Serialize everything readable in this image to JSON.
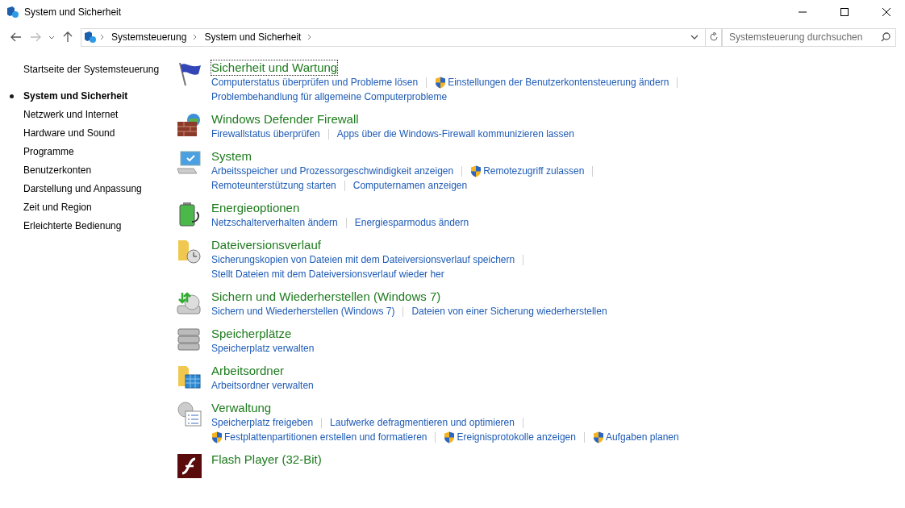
{
  "window": {
    "title": "System und Sicherheit"
  },
  "address_bar": {
    "crumbs": [
      "Systemsteuerung",
      "System und Sicherheit"
    ]
  },
  "search": {
    "placeholder": "Systemsteuerung durchsuchen"
  },
  "sidebar": {
    "items": [
      {
        "label": "Startseite der Systemsteuerung",
        "selected": false,
        "kind": "home"
      },
      {
        "label": "System und Sicherheit",
        "selected": true,
        "kind": "item"
      },
      {
        "label": "Netzwerk und Internet",
        "selected": false,
        "kind": "item"
      },
      {
        "label": "Hardware und Sound",
        "selected": false,
        "kind": "item"
      },
      {
        "label": "Programme",
        "selected": false,
        "kind": "item"
      },
      {
        "label": "Benutzerkonten",
        "selected": false,
        "kind": "item"
      },
      {
        "label": "Darstellung und Anpassung",
        "selected": false,
        "kind": "item"
      },
      {
        "label": "Zeit und Region",
        "selected": false,
        "kind": "item"
      },
      {
        "label": "Erleichterte Bedienung",
        "selected": false,
        "kind": "item"
      }
    ]
  },
  "categories": [
    {
      "kind": "flag",
      "title": "Sicherheit und Wartung",
      "focused": true,
      "lines": [
        [
          {
            "label": "Computerstatus überprüfen und Probleme lösen",
            "shield": false
          },
          {
            "label": "Einstellungen der Benutzerkontensteuerung ändern",
            "shield": true
          }
        ],
        [
          {
            "label": "Problembehandlung für allgemeine Computerprobleme",
            "shield": false
          }
        ]
      ]
    },
    {
      "kind": "firewall",
      "title": "Windows Defender Firewall",
      "focused": false,
      "lines": [
        [
          {
            "label": "Firewallstatus überprüfen",
            "shield": false
          },
          {
            "label": "Apps über die Windows-Firewall kommunizieren lassen",
            "shield": false
          }
        ]
      ]
    },
    {
      "kind": "monitor",
      "title": "System",
      "focused": false,
      "lines": [
        [
          {
            "label": "Arbeitsspeicher und Prozessorgeschwindigkeit anzeigen",
            "shield": false
          },
          {
            "label": "Remotezugriff zulassen",
            "shield": true
          }
        ],
        [
          {
            "label": "Remoteunterstützung starten",
            "shield": false
          },
          {
            "label": "Computernamen anzeigen",
            "shield": false
          }
        ]
      ]
    },
    {
      "kind": "battery",
      "title": "Energieoptionen",
      "focused": false,
      "lines": [
        [
          {
            "label": "Netzschalterverhalten ändern",
            "shield": false
          },
          {
            "label": "Energiesparmodus ändern",
            "shield": false
          }
        ]
      ]
    },
    {
      "kind": "history",
      "title": "Dateiversionsverlauf",
      "focused": false,
      "lines": [
        [
          {
            "label": "Sicherungskopien von Dateien mit dem Dateiversionsverlauf speichern",
            "shield": false
          }
        ],
        [
          {
            "label": "Stellt Dateien mit dem Dateiversionsverlauf wieder her",
            "shield": false
          }
        ]
      ]
    },
    {
      "kind": "backup",
      "title": "Sichern und Wiederherstellen (Windows 7)",
      "focused": false,
      "lines": [
        [
          {
            "label": "Sichern und Wiederherstellen (Windows 7)",
            "shield": false
          },
          {
            "label": "Dateien von einer Sicherung wiederherstellen",
            "shield": false
          }
        ]
      ]
    },
    {
      "kind": "drives",
      "title": "Speicherplätze",
      "focused": false,
      "lines": [
        [
          {
            "label": "Speicherplatz verwalten",
            "shield": false
          }
        ]
      ]
    },
    {
      "kind": "workfolder",
      "title": "Arbeitsordner",
      "focused": false,
      "lines": [
        [
          {
            "label": "Arbeitsordner verwalten",
            "shield": false
          }
        ]
      ]
    },
    {
      "kind": "tools",
      "title": "Verwaltung",
      "focused": false,
      "lines": [
        [
          {
            "label": "Speicherplatz freigeben",
            "shield": false
          },
          {
            "label": "Laufwerke defragmentieren und optimieren",
            "shield": false
          }
        ],
        [
          {
            "label": "Festplattenpartitionen erstellen und formatieren",
            "shield": true
          },
          {
            "label": "Ereignisprotokolle anzeigen",
            "shield": true
          },
          {
            "label": "Aufgaben planen",
            "shield": true
          }
        ]
      ]
    },
    {
      "kind": "flash",
      "title": "Flash Player (32-Bit)",
      "focused": false
    }
  ]
}
